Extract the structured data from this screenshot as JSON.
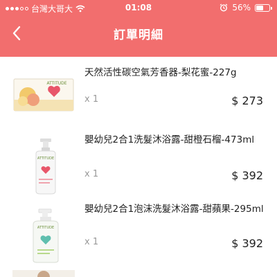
{
  "status_bar": {
    "carrier": "台灣大哥大",
    "time": "01:08",
    "battery": "56%",
    "battery_level": 0.56
  },
  "nav": {
    "title": "訂單明細"
  },
  "items": [
    {
      "name": "天然活性碳空氣芳香器-梨花蜜-227g",
      "qty": "x 1",
      "price": "$ 273",
      "brand": "ATTITUDE"
    },
    {
      "name": "嬰幼兒2合1洗髮沐浴露-甜橙石榴-473ml",
      "qty": "x 1",
      "price": "$ 392",
      "brand": "ATTITUDE"
    },
    {
      "name": "嬰幼兒2合1泡沫洗髮沐浴露-甜蘋果-295ml",
      "qty": "x 1",
      "price": "$ 392",
      "brand": "ATTITUDE"
    }
  ],
  "icons": {
    "back": "chevron-left-icon",
    "wifi": "wifi-icon",
    "alarm": "alarm-icon",
    "battery": "battery-icon"
  },
  "colors": {
    "header": "#f26e6e",
    "card": "#ffffff"
  }
}
